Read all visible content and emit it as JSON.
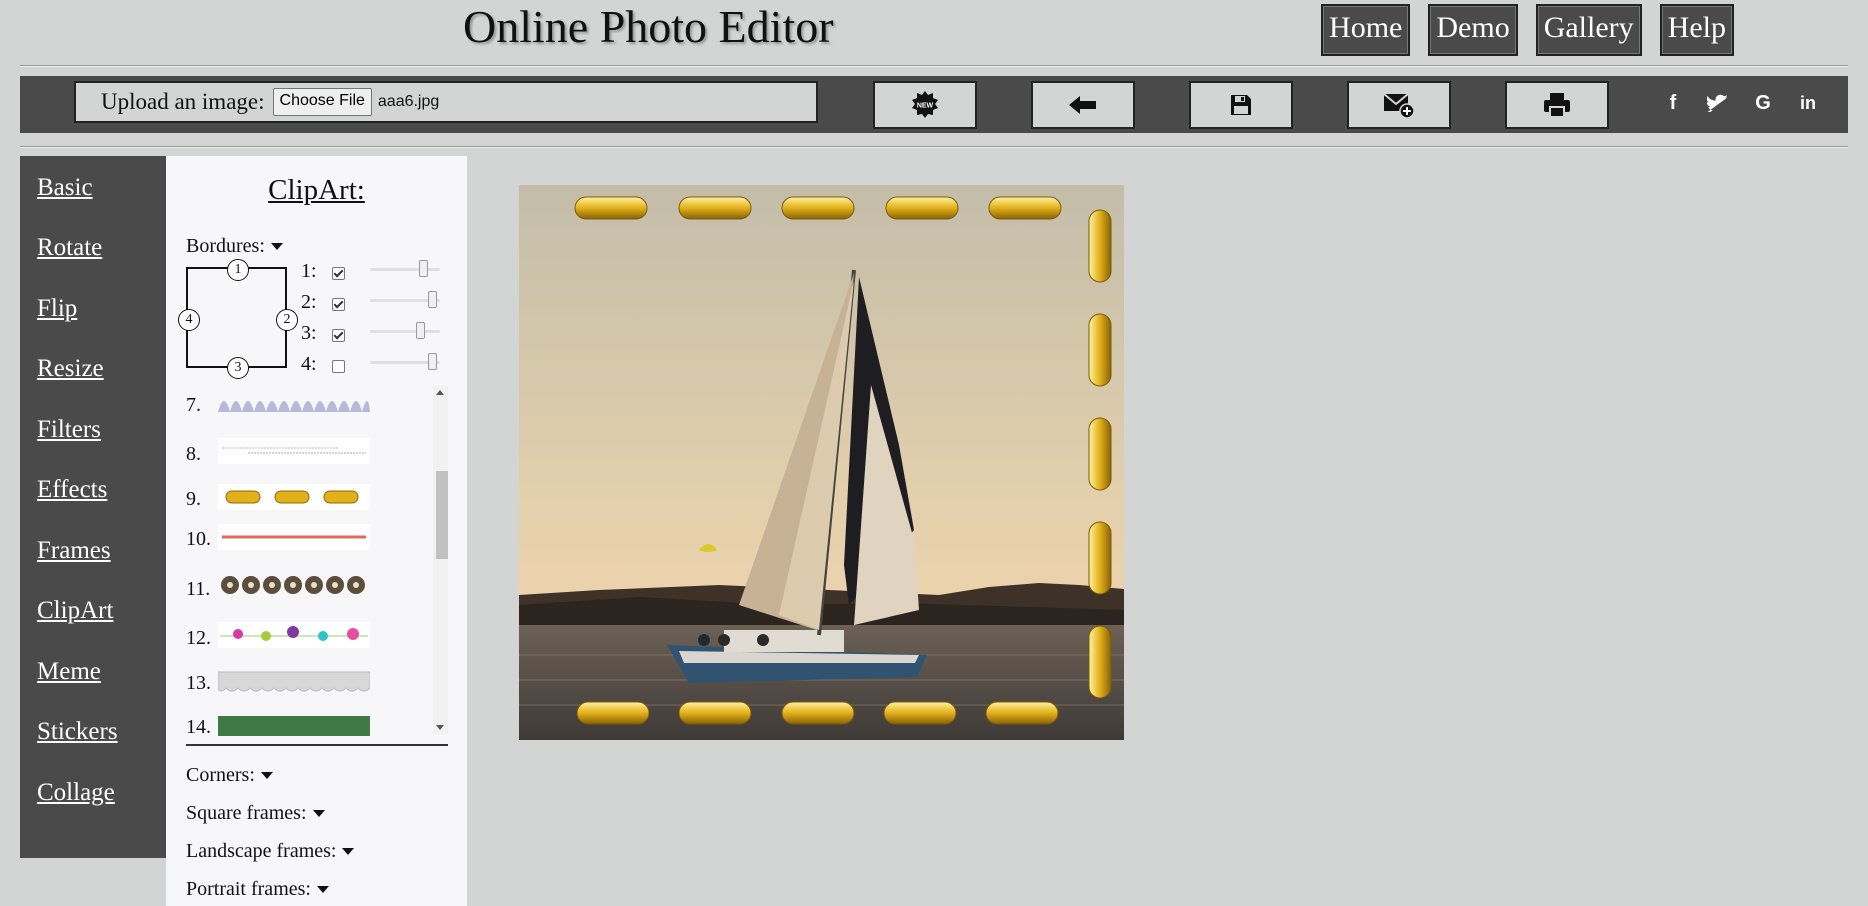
{
  "header": {
    "title": "Online Photo Editor",
    "nav": [
      "Home",
      "Demo",
      "Gallery",
      "Help"
    ]
  },
  "toolbar": {
    "upload_label": "Upload an image:",
    "choose_file_label": "Choose File",
    "file_name": "aaa6.jpg",
    "buttons": [
      {
        "icon": "new-badge-icon",
        "badge_text": "NEW"
      },
      {
        "icon": "arrow-left-icon"
      },
      {
        "icon": "save-floppy-icon"
      },
      {
        "icon": "email-add-icon"
      },
      {
        "icon": "print-icon"
      }
    ],
    "social": [
      {
        "icon": "facebook-icon",
        "glyph": "f"
      },
      {
        "icon": "twitter-icon",
        "glyph": "t"
      },
      {
        "icon": "google-icon",
        "glyph": "G"
      },
      {
        "icon": "linkedin-icon",
        "glyph": "in"
      }
    ]
  },
  "sidebar": {
    "items": [
      "Basic",
      "Rotate",
      "Flip",
      "Resize",
      "Filters",
      "Effects",
      "Frames",
      "ClipArt",
      "Meme",
      "Stickers",
      "Collage"
    ]
  },
  "panel": {
    "title": "ClipArt:",
    "bordures_label": "Bordures:",
    "diagram_badges": [
      "1",
      "2",
      "3",
      "4"
    ],
    "border_rows": [
      {
        "label": "1:",
        "checked": true,
        "slider": 0.8
      },
      {
        "label": "2:",
        "checked": true,
        "slider": 0.95
      },
      {
        "label": "3:",
        "checked": true,
        "slider": 0.75
      },
      {
        "label": "4:",
        "checked": false,
        "slider": 0.95
      }
    ],
    "list_items": [
      "7.",
      "8.",
      "9.",
      "10.",
      "11.",
      "12.",
      "13.",
      "14."
    ],
    "sections": [
      "Corners:",
      "Square frames:",
      "Landscape frames:",
      "Portrait frames:"
    ]
  },
  "colors": {
    "dark_panel": "#4a4a4a",
    "page_bg": "#d3d4d4",
    "gold": "#e2b019"
  }
}
